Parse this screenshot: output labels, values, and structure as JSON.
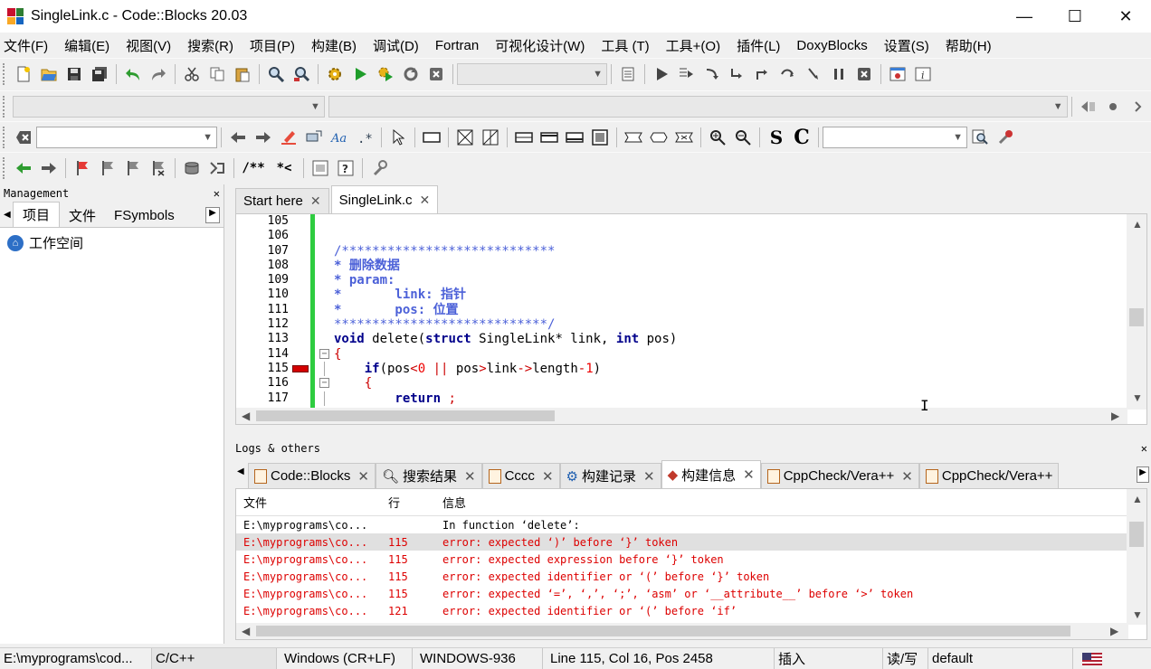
{
  "window": {
    "title": "SingleLink.c - Code::Blocks 20.03",
    "minimize": "—",
    "maximize": "☐",
    "close": "✕"
  },
  "menu": [
    "文件(F)",
    "编辑(E)",
    "视图(V)",
    "搜索(R)",
    "项目(P)",
    "构建(B)",
    "调试(D)",
    "Fortran",
    "可视化设计(W)",
    "工具 (T)",
    "工具+(O)",
    "插件(L)",
    "DoxyBlocks",
    "设置(S)",
    "帮助(H)"
  ],
  "toolbar3": {
    "comment_block": "/**",
    "comment_line": "*<"
  },
  "toolbar2": {
    "s_label": "S",
    "c_label": "C"
  },
  "management": {
    "title": "Management",
    "close": "✕",
    "tabs": [
      "项目",
      "文件",
      "FSymbols"
    ],
    "workspace": "工作空间"
  },
  "editor": {
    "tabs": [
      {
        "label": "Start here",
        "active": false
      },
      {
        "label": "SingleLink.c",
        "active": true
      }
    ],
    "lines": [
      {
        "n": "105"
      },
      {
        "n": "106"
      },
      {
        "n": "107",
        "comment": "/****************************"
      },
      {
        "n": "108",
        "comment": "* 删除数据"
      },
      {
        "n": "109",
        "comment": "* param:"
      },
      {
        "n": "110",
        "comment": "*       link: 指针"
      },
      {
        "n": "111",
        "comment": "*       pos: 位置"
      },
      {
        "n": "112",
        "comment": "****************************/"
      },
      {
        "n": "113",
        "kw1": "void",
        "t1": " delete(",
        "kw2": "struct",
        "t2": " SingleLink* link, ",
        "kw3": "int",
        "t3": " pos)"
      },
      {
        "n": "114",
        "plain": "{"
      },
      {
        "n": "115",
        "kw1": "    if",
        "t1": "(pos",
        "op1": "<",
        "num1": "0",
        "t2": " ",
        "op2": "||",
        "t3": " pos",
        "op3": ">",
        "t4": "link",
        "op4": "->",
        "t5": "length",
        "op5": "-",
        "num2": "1",
        "t6": ")"
      },
      {
        "n": "116",
        "plain": "    {"
      },
      {
        "n": "117",
        "kw1": "        return",
        "t1": " ;"
      }
    ]
  },
  "logs": {
    "title": "Logs & others",
    "close": "✕",
    "tabs": [
      {
        "label": "Code::Blocks",
        "active": false
      },
      {
        "label": "搜索结果",
        "active": false
      },
      {
        "label": "Cccc",
        "active": false
      },
      {
        "label": "构建记录",
        "active": false
      },
      {
        "label": "构建信息",
        "active": true
      },
      {
        "label": "CppCheck/Vera++",
        "active": false
      },
      {
        "label": "CppCheck/Vera++",
        "active": false
      }
    ],
    "headers": {
      "file": "文件",
      "line": "行",
      "message": "信息"
    },
    "rows": [
      {
        "file": "E:\\myprograms\\co...",
        "line": "",
        "message": "In function ‘delete’:",
        "error": false,
        "selected": false
      },
      {
        "file": "E:\\myprograms\\co...",
        "line": "115",
        "message": "error: expected ‘)’ before ‘}’ token",
        "error": true,
        "selected": true
      },
      {
        "file": "E:\\myprograms\\co...",
        "line": "115",
        "message": "error: expected expression before ‘}’ token",
        "error": true,
        "selected": false
      },
      {
        "file": "E:\\myprograms\\co...",
        "line": "115",
        "message": "error: expected identifier or ‘(’ before ‘}’ token",
        "error": true,
        "selected": false
      },
      {
        "file": "E:\\myprograms\\co...",
        "line": "115",
        "message": "error: expected ‘=’, ‘,’, ‘;’, ‘asm’ or ‘__attribute__’ before ‘>’ token",
        "error": true,
        "selected": false
      },
      {
        "file": "E:\\myprograms\\co...",
        "line": "121",
        "message": "error: expected identifier or ‘(’ before ‘if’",
        "error": true,
        "selected": false
      }
    ]
  },
  "status": {
    "path": "E:\\myprograms\\cod...",
    "lang": "C/C++",
    "eol": "Windows (CR+LF)",
    "encoding": "WINDOWS-936",
    "position": "Line 115, Col 16, Pos 2458",
    "mode": "插入",
    "rw": "读/写",
    "profile": "default"
  },
  "colors": {
    "gutter_change": "#2ecc40",
    "error_text": "#dd0000",
    "comment": "#4c61d8",
    "keyword": "#00008b"
  }
}
